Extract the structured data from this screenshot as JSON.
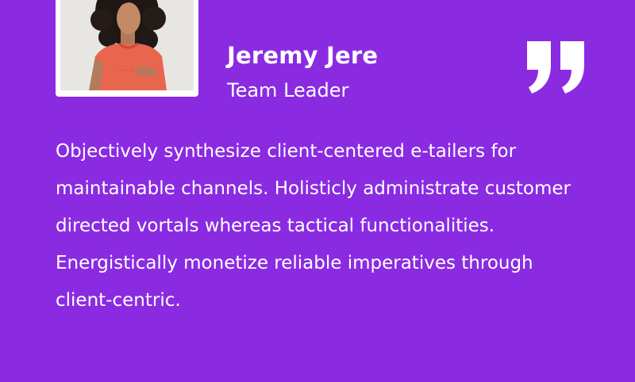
{
  "testimonial": {
    "name": "Jeremy Jere",
    "role": "Team Leader",
    "quote": "Objectively synthesize client-centered e-tailers for maintainable channels. Holisticly administrate customer directed vortals whereas tactical functionalities. Energistically monetize reliable imperatives through client-centric.",
    "quote_icon": "double-quote-icon",
    "avatar_icon": "person-photo"
  },
  "colors": {
    "background": "#8a2be2",
    "text": "#ffffff",
    "frame": "#ffffff"
  }
}
